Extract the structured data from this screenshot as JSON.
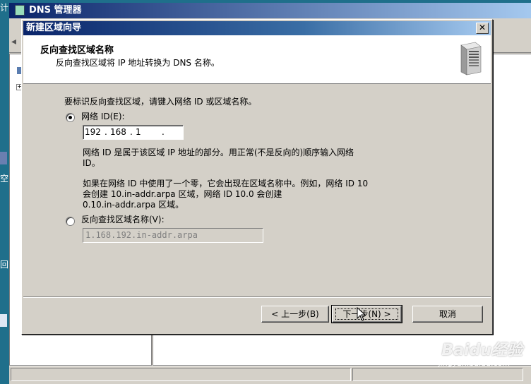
{
  "background_window": {
    "title": "DNS 管理器"
  },
  "desktop_fragments": {
    "top_left": "计",
    "mid_left": "空",
    "lower_left": "回"
  },
  "wizard": {
    "title": "新建区域向导",
    "header_title": "反向查找区域名称",
    "header_subtitle": "反向查找区域将 IP 地址转换为 DNS 名称。",
    "intro": "要标识反向查找区域，请键入网络 ID 或区域名称。",
    "network_id_radio_label": "网络 ID(E):",
    "network_id_selected": true,
    "ip_segments": [
      "192",
      "168",
      "1",
      ""
    ],
    "network_id_help_line1": "网络 ID 是属于该区域 IP 地址的部分。用正常(不是反向的)顺序输入网络",
    "network_id_help_line2": "ID。",
    "zero_help_line1": "如果在网络 ID 中使用了一个零，它会出现在区域名称中。例如，网络 ID 10",
    "zero_help_line2": "会创建 10.in-addr.arpa 区域，网络 ID 10.0 会创建",
    "zero_help_line3": "0.10.in-addr.arpa 区域。",
    "zone_name_radio_label": "反向查找区域名称(V):",
    "zone_name_value": "1.168.192.in-addr.arpa",
    "buttons": {
      "back": "< 上一步(B)",
      "next": "下一步(N) >",
      "cancel": "取消"
    }
  },
  "watermark": {
    "brand": "Baidu经验",
    "url": "jingyan.baidu.com"
  }
}
